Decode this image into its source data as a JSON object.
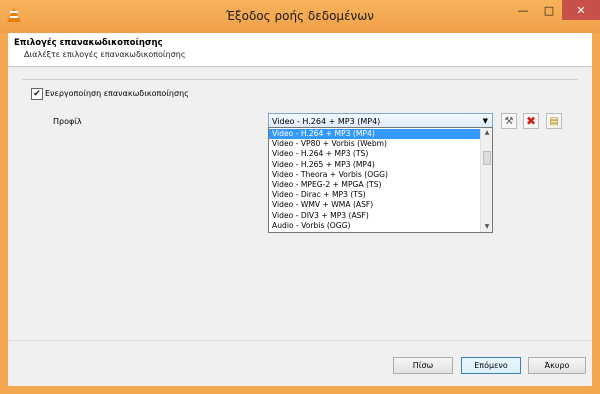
{
  "window": {
    "title": "Έξοδος ροής δεδομένων",
    "min_symbol": "—",
    "max_symbol": "□",
    "close_symbol": "✕"
  },
  "header": {
    "title": "Επιλογές επανακωδικοποίησης",
    "subtitle": "Διαλέξτε επιλογές επανακωδικοποίησης"
  },
  "transcode": {
    "checkbox_label": "Ενεργοποίηση επανακωδικοποίησης",
    "checked": true,
    "check_mark": "✔"
  },
  "profile": {
    "label": "Προφίλ",
    "selected": "Video - H.264 + MP3 (MP4)",
    "arrow": "▼",
    "options": [
      "Video - H.264 + MP3 (MP4)",
      "Video - VP80 + Vorbis (Webm)",
      "Video - H.264 + MP3 (TS)",
      "Video - H.265 + MP3 (MP4)",
      "Video - Theora + Vorbis (OGG)",
      "Video - MPEG-2 + MPGA (TS)",
      "Video - Dirac + MP3 (TS)",
      "Video - WMV + WMA (ASF)",
      "Video - DIV3 + MP3 (ASF)",
      "Audio - Vorbis (OGG)"
    ],
    "scroll_up": "▲",
    "scroll_down": "▼"
  },
  "tools": {
    "edit_icon": "wrench-screwdriver-icon",
    "delete_icon": "red-x-icon",
    "new_icon": "notepad-icon",
    "edit_glyph": "⚒",
    "delete_glyph": "✖",
    "new_glyph": "▤"
  },
  "buttons": {
    "back": "Πίσω",
    "next": "Επόμενο",
    "cancel": "Άκυρο"
  },
  "colors": {
    "frame": "#f3a74f",
    "selection": "#3399ff",
    "close": "#c7504a"
  }
}
